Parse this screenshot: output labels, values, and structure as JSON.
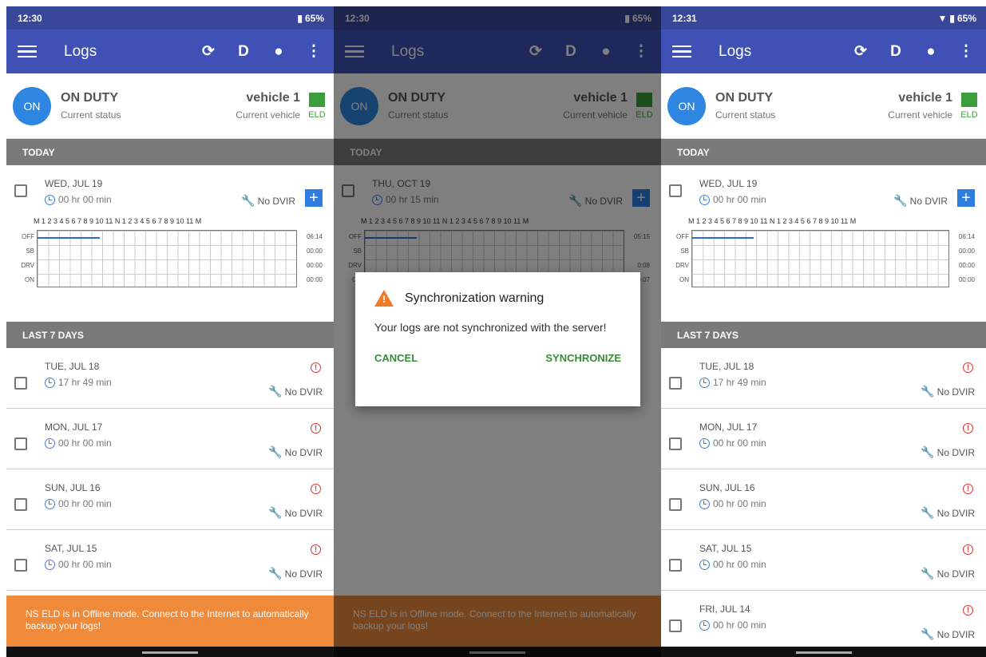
{
  "screens": [
    {
      "time": "12:30",
      "battery": "65%",
      "appbar_title": "Logs",
      "mode_letter": "D",
      "status": {
        "badge": "ON",
        "label": "ON DUTY",
        "sublabel": "Current status"
      },
      "vehicle": {
        "name": "vehicle 1",
        "sublabel": "Current vehicle",
        "eld": "ELD"
      },
      "today_header": "TODAY",
      "today": {
        "day": "WED, JUL 19",
        "time": "00 hr 00 min",
        "dvir": "No DVIR",
        "hours": "M 1 2 3 4 5 6 7 8 9 10 11 N 1 2 3 4 5 6 7 8 9 10 11 M",
        "rows": [
          "OFF",
          "SB",
          "DRV",
          "ON"
        ],
        "totals": [
          "06:14",
          "00:00",
          "00:00",
          "00:00"
        ],
        "off_fraction": 0.24
      },
      "last7_header": "LAST 7 DAYS",
      "days": [
        {
          "day": "TUE, JUL 18",
          "time": "17 hr 49 min",
          "dvir": "No DVIR"
        },
        {
          "day": "MON, JUL 17",
          "time": "00 hr 00 min",
          "dvir": "No DVIR"
        },
        {
          "day": "SUN, JUL 16",
          "time": "00 hr 00 min",
          "dvir": "No DVIR"
        },
        {
          "day": "SAT, JUL 15",
          "time": "00 hr 00 min",
          "dvir": "No DVIR"
        }
      ],
      "banner": "NS ELD is in Offline mode. Connect to the Internet to automatically backup your logs!"
    },
    {
      "time": "12:30",
      "battery": "65%",
      "appbar_title": "Logs",
      "mode_letter": "D",
      "status": {
        "badge": "ON",
        "label": "ON DUTY",
        "sublabel": "Current status"
      },
      "vehicle": {
        "name": "vehicle 1",
        "sublabel": "Current vehicle",
        "eld": "ELD"
      },
      "today_header": "TODAY",
      "today": {
        "day": "THU, OCT 19",
        "time": "00 hr 15 min",
        "dvir": "No DVIR",
        "hours": "M 1 2 3 4 5 6 7 8 9 10 11 N 1 2 3 4 5 6 7 8 9 10 11 M",
        "rows": [
          "OFF",
          "SB",
          "DRV",
          "ON"
        ],
        "totals": [
          "05:15",
          "",
          "0:08",
          "0:07"
        ],
        "off_fraction": 0.2
      },
      "banner": "NS ELD is in Offline mode. Connect to the Internet to automatically backup your logs!",
      "dialog": {
        "title": "Synchronization warning",
        "message": "Your logs are not synchronized with the server!",
        "cancel": "CANCEL",
        "confirm": "SYNCHRONIZE"
      }
    },
    {
      "time": "12:31",
      "battery": "65%",
      "appbar_title": "Logs",
      "mode_letter": "D",
      "status": {
        "badge": "ON",
        "label": "ON DUTY",
        "sublabel": "Current status"
      },
      "vehicle": {
        "name": "vehicle 1",
        "sublabel": "Current vehicle",
        "eld": "ELD"
      },
      "today_header": "TODAY",
      "today": {
        "day": "WED, JUL 19",
        "time": "00 hr 00 min",
        "dvir": "No DVIR",
        "hours": "M 1 2 3 4 5 6 7 8 9 10 11 N 1 2 3 4 5 6 7 8 9 10 11 M",
        "rows": [
          "OFF",
          "SB",
          "DRV",
          "ON"
        ],
        "totals": [
          "06:14",
          "00:00",
          "00:00",
          "00:00"
        ],
        "off_fraction": 0.24
      },
      "last7_header": "LAST 7 DAYS",
      "days": [
        {
          "day": "TUE, JUL 18",
          "time": "17 hr 49 min",
          "dvir": "No DVIR"
        },
        {
          "day": "MON, JUL 17",
          "time": "00 hr 00 min",
          "dvir": "No DVIR"
        },
        {
          "day": "SUN, JUL 16",
          "time": "00 hr 00 min",
          "dvir": "No DVIR"
        },
        {
          "day": "SAT, JUL 15",
          "time": "00 hr 00 min",
          "dvir": "No DVIR"
        },
        {
          "day": "FRI, JUL 14",
          "time": "00 hr 00 min",
          "dvir": "No DVIR"
        }
      ]
    }
  ]
}
